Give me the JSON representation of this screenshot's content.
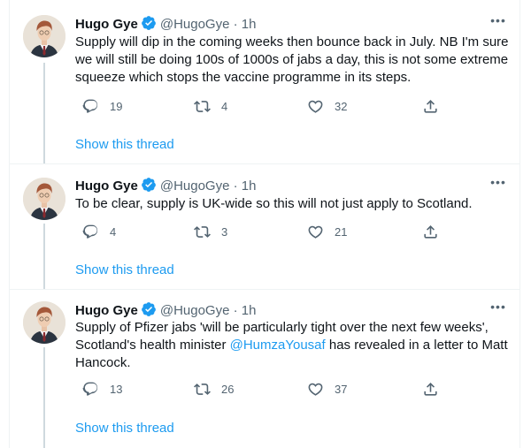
{
  "accent_color": "#1d9bf0",
  "tweets": [
    {
      "author_name": "Hugo Gye",
      "handle": "@HugoGye",
      "separator": "·",
      "time": "1h",
      "text": "Supply will dip in the coming weeks then bounce back in July. NB I'm sure we will still be doing 100s of 1000s of jabs a day, this is not some extreme squeeze which stops the vaccine programme in its steps.",
      "reply_count": "19",
      "retweet_count": "4",
      "like_count": "32",
      "show_thread": "Show this thread"
    },
    {
      "author_name": "Hugo Gye",
      "handle": "@HugoGye",
      "separator": "·",
      "time": "1h",
      "text": "To be clear, supply is UK-wide so this will not just apply to Scotland.",
      "reply_count": "4",
      "retweet_count": "3",
      "like_count": "21",
      "show_thread": "Show this thread"
    },
    {
      "author_name": "Hugo Gye",
      "handle": "@HugoGye",
      "separator": "·",
      "time": "1h",
      "text_before": "Supply of Pfizer jabs 'will be particularly tight over the next few weeks', Scotland's health minister ",
      "mention": "@HumzaYousaf",
      "text_after": " has revealed in a letter to Matt Hancock.",
      "reply_count": "13",
      "retweet_count": "26",
      "like_count": "37",
      "show_thread": "Show this thread"
    }
  ]
}
